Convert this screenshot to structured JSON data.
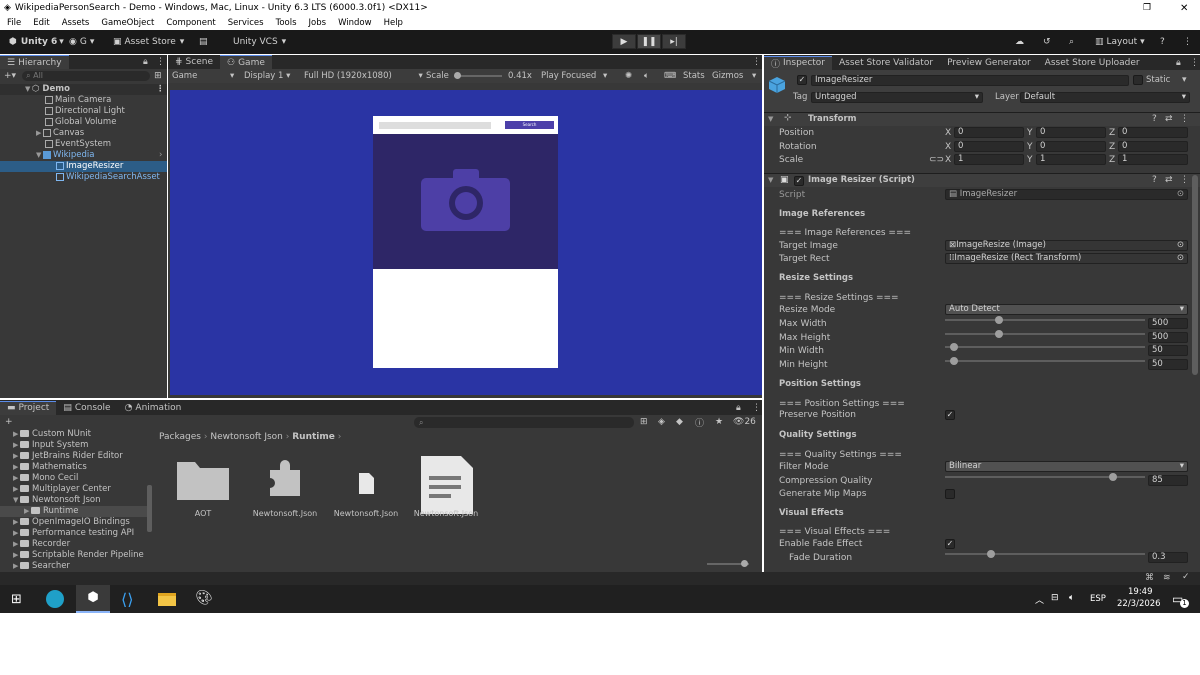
{
  "window": {
    "title": "WikipediaPersonSearch - Demo - Windows, Mac, Linux - Unity 6.3 LTS (6000.3.0f1) <DX11>"
  },
  "menu": [
    "File",
    "Edit",
    "Assets",
    "GameObject",
    "Component",
    "Services",
    "Tools",
    "Jobs",
    "Window",
    "Help"
  ],
  "toolbar": {
    "account": "Unity 6",
    "user": "G",
    "asset_store": "Asset Store",
    "vcs": "Unity VCS",
    "layout": "Layout"
  },
  "hierarchy": {
    "tab": "Hierarchy",
    "search_placeholder": "All",
    "scene": "Demo",
    "items": [
      {
        "label": "Main Camera"
      },
      {
        "label": "Directional Light"
      },
      {
        "label": "Global Volume"
      },
      {
        "label": "Canvas"
      },
      {
        "label": "EventSystem"
      },
      {
        "label": "Wikipedia"
      },
      {
        "label": "ImageResizer"
      },
      {
        "label": "WikipediaSearchAsset"
      }
    ]
  },
  "scene_view": {
    "tab_scene": "Scene",
    "tab_game": "Game",
    "display_mode": "Game",
    "display": "Display 1",
    "resolution": "Full HD (1920x1080)",
    "scale_label": "Scale",
    "scale_value": "0.41x",
    "play_focused": "Play Focused",
    "stats": "Stats",
    "gizmos": "Gizmos",
    "search_button": "Search",
    "colors": {
      "background": "#2a34a4",
      "image_area": "#2e2667",
      "camera": "#4d3fa6",
      "button": "#4c3fa9"
    }
  },
  "project": {
    "tabs": [
      "Project",
      "Console",
      "Animation"
    ],
    "tree": [
      {
        "label": "Custom NUnit"
      },
      {
        "label": "Input System"
      },
      {
        "label": "JetBrains Rider Editor"
      },
      {
        "label": "Mathematics"
      },
      {
        "label": "Mono Cecil"
      },
      {
        "label": "Multiplayer Center"
      },
      {
        "label": "Newtonsoft Json"
      },
      {
        "label": "Runtime"
      },
      {
        "label": "OpenImageIO Bindings"
      },
      {
        "label": "Performance testing API"
      },
      {
        "label": "Recorder"
      },
      {
        "label": "Scriptable Render Pipeline"
      },
      {
        "label": "Searcher"
      }
    ],
    "breadcrumb": [
      "Packages",
      "Newtonsoft Json",
      "Runtime"
    ],
    "hidden_count": "26",
    "assets": [
      {
        "label": "AOT",
        "icon": "folder-icon"
      },
      {
        "label": "Newtonsoft.Json",
        "icon": "assembly-icon"
      },
      {
        "label": "Newtonsoft.Json",
        "icon": "file-icon"
      },
      {
        "label": "Newtonsoft.Json",
        "icon": "document-icon"
      }
    ]
  },
  "inspector": {
    "tabs": [
      "Inspector",
      "Asset Store Validator",
      "Preview Generator",
      "Asset Store Uploader"
    ],
    "object_name": "ImageResizer",
    "static_label": "Static",
    "tag_label": "Tag",
    "tag": "Untagged",
    "layer_label": "Layer",
    "layer": "Default",
    "transform": {
      "title": "Transform",
      "position": {
        "label": "Position",
        "x": "0",
        "y": "0",
        "z": "0"
      },
      "rotation": {
        "label": "Rotation",
        "x": "0",
        "y": "0",
        "z": "0"
      },
      "scale": {
        "label": "Scale",
        "x": "1",
        "y": "1",
        "z": "1"
      }
    },
    "script_component": {
      "title": "Image Resizer (Script)",
      "script_label": "Script",
      "script_value": "ImageResizer",
      "h_image_refs": "Image References",
      "hdr_image_refs": "=== Image References ===",
      "target_image_label": "Target Image",
      "target_image": "ImageResize (Image)",
      "target_rect_label": "Target Rect",
      "target_rect": "ImageResize (Rect Transform)",
      "h_resize": "Resize Settings",
      "hdr_resize": "=== Resize Settings ===",
      "resize_mode_label": "Resize Mode",
      "resize_mode": "Auto Detect",
      "max_width_label": "Max Width",
      "max_width": "500",
      "max_height_label": "Max Height",
      "max_height": "500",
      "min_width_label": "Min Width",
      "min_width": "50",
      "min_height_label": "Min Height",
      "min_height": "50",
      "h_position": "Position Settings",
      "hdr_position": "=== Position Settings ===",
      "preserve_position_label": "Preserve Position",
      "preserve_position": true,
      "h_quality": "Quality Settings",
      "hdr_quality": "=== Quality Settings ===",
      "filter_mode_label": "Filter Mode",
      "filter_mode": "Bilinear",
      "compression_label": "Compression Quality",
      "compression": "85",
      "mipmaps_label": "Generate Mip Maps",
      "mipmaps": false,
      "h_visual": "Visual Effects",
      "hdr_visual": "=== Visual Effects ===",
      "fade_label": "Enable Fade Effect",
      "fade": true,
      "fade_duration_label": "Fade Duration",
      "fade_duration": "0.3"
    }
  },
  "taskbar": {
    "lang": "ESP",
    "time": "19:49",
    "date": "22/3/2026",
    "notif": "1"
  }
}
